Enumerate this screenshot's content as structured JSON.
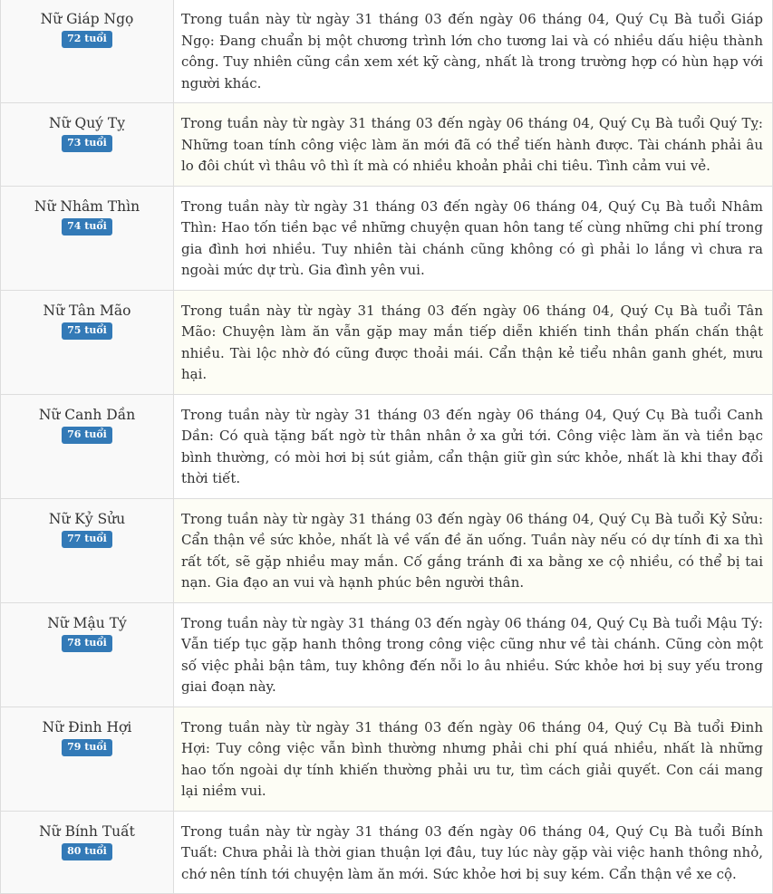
{
  "rows": [
    {
      "name": "Nữ Giáp Ngọ",
      "age": "72 tuổi",
      "text": "Trong tuần này từ ngày 31 tháng 03 đến ngày 06 tháng 04, Quý Cụ Bà tuổi Giáp Ngọ: Đang chuẩn bị một chương trình lớn cho tương lai và có nhiều dấu hiệu thành công. Tuy nhiên cũng cần xem xét kỹ càng, nhất là trong trường hợp có hùn hạp với người khác."
    },
    {
      "name": "Nữ Quý Tỵ",
      "age": "73 tuổi",
      "text": "Trong tuần này từ ngày 31 tháng 03 đến ngày 06 tháng 04, Quý Cụ Bà tuổi Quý Tỵ: Những toan tính công việc làm ăn mới đã có thể tiến hành được. Tài chánh phải âu lo đôi chút vì thâu vô thì ít mà có nhiều khoản phải chi tiêu. Tình cảm vui vẻ."
    },
    {
      "name": "Nữ Nhâm Thìn",
      "age": "74 tuổi",
      "text": "Trong tuần này từ ngày 31 tháng 03 đến ngày 06 tháng 04, Quý Cụ Bà tuổi Nhâm Thìn: Hao tốn tiền bạc về những chuyện quan hôn tang tế cùng những chi phí trong gia đình hơi nhiều. Tuy nhiên tài chánh cũng không có gì phải lo lắng vì chưa ra ngoài mức dự trù. Gia đình yên vui."
    },
    {
      "name": "Nữ Tân Mão",
      "age": "75 tuổi",
      "text": "Trong tuần này từ ngày 31 tháng 03 đến ngày 06 tháng 04, Quý Cụ Bà tuổi Tân Mão: Chuyện làm ăn vẫn gặp may mắn tiếp diễn khiến tinh thần phấn chấn thật nhiều. Tài lộc nhờ đó cũng được thoải mái. Cẩn thận kẻ tiểu nhân ganh ghét, mưu hại."
    },
    {
      "name": "Nữ Canh Dần",
      "age": "76 tuổi",
      "text": "Trong tuần này từ ngày 31 tháng 03 đến ngày 06 tháng 04, Quý Cụ Bà tuổi Canh Dần: Có quà tặng bất ngờ từ thân nhân ở xa gửi tới. Công việc làm ăn và tiền bạc bình thường, có mòi hơi bị sút giảm, cẩn thận giữ gìn sức khỏe, nhất là khi thay đổi thời tiết."
    },
    {
      "name": "Nữ Kỷ Sửu",
      "age": "77 tuổi",
      "text": "Trong tuần này từ ngày 31 tháng 03 đến ngày 06 tháng 04, Quý Cụ Bà tuổi Kỷ Sửu: Cẩn thận về sức khỏe, nhất là về vấn đề ăn uống. Tuần này nếu có dự tính đi xa thì rất tốt, sẽ gặp nhiều may mắn. Cố gắng tránh đi xa bằng xe cộ nhiều, có thể bị tai nạn. Gia đạo an vui và hạnh phúc bên người thân."
    },
    {
      "name": "Nữ Mậu Tý",
      "age": "78 tuổi",
      "text": "Trong tuần này từ ngày 31 tháng 03 đến ngày 06 tháng 04, Quý Cụ Bà tuổi Mậu Tý: Vẫn tiếp tục gặp hanh thông trong công việc cũng như về tài chánh. Cũng còn một số việc phải bận tâm, tuy không đến nỗi lo âu nhiều. Sức khỏe hơi bị suy yếu trong giai đoạn này."
    },
    {
      "name": "Nữ Đinh Hợi",
      "age": "79 tuổi",
      "text": "Trong tuần này từ ngày 31 tháng 03 đến ngày 06 tháng 04, Quý Cụ Bà tuổi Đinh Hợi: Tuy công việc vẫn bình thường nhưng phải chi phí quá nhiều, nhất là những hao tốn ngoài dự tính khiến thường phải ưu tư, tìm cách giải quyết. Con cái mang lại niềm vui."
    },
    {
      "name": "Nữ Bính Tuất",
      "age": "80 tuổi",
      "text": "Trong tuần này từ ngày 31 tháng 03 đến ngày 06 tháng 04, Quý Cụ Bà tuổi Bính Tuất: Chưa phải là thời gian thuận lợi đâu, tuy lúc này gặp vài việc hanh thông nhỏ, chớ nên tính tới chuyện làm ăn mới. Sức khỏe hơi bị suy kém. Cẩn thận về xe cộ."
    }
  ]
}
